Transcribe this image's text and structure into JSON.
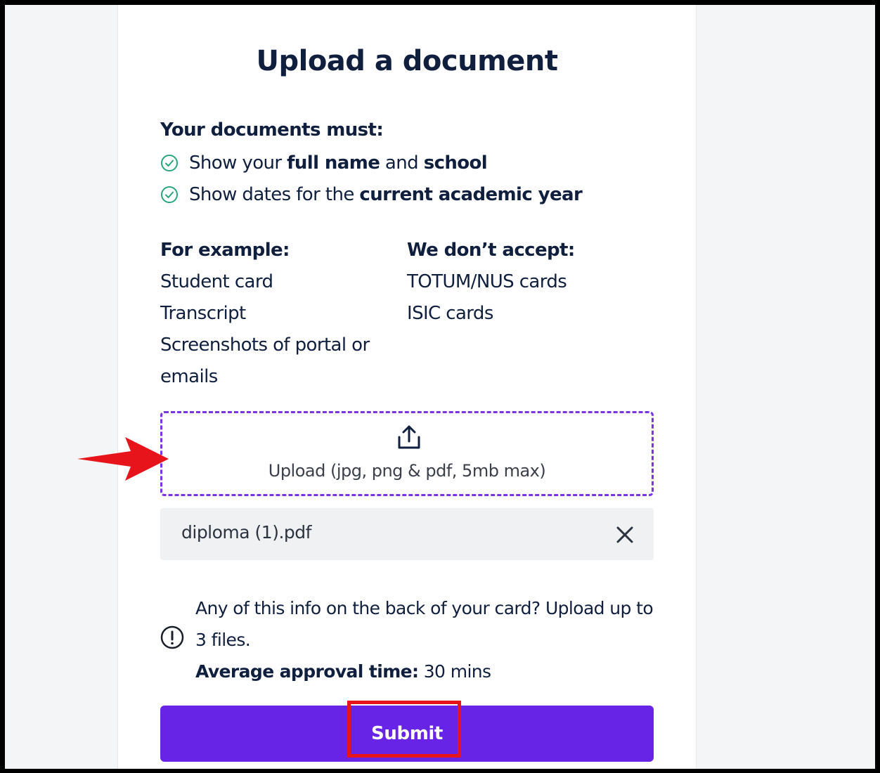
{
  "page": {
    "title": "Upload a document"
  },
  "requirements": {
    "heading": "Your documents must:",
    "items": [
      {
        "parts": [
          "Show your ",
          "full name",
          " and ",
          "school"
        ]
      },
      {
        "parts": [
          "Show dates for the ",
          "current academic year"
        ]
      }
    ]
  },
  "examples": {
    "heading": "For example:",
    "lines": [
      "Student card",
      "Transcript",
      "Screenshots of portal or",
      "emails"
    ]
  },
  "not_accepted": {
    "heading": "We don’t accept:",
    "lines": [
      "TOTUM/NUS cards",
      "ISIC cards"
    ]
  },
  "upload": {
    "label": "Upload (jpg, png & pdf, 5mb max)",
    "icon": "upload-icon",
    "border_color": "#7a34e0"
  },
  "file": {
    "name": "diploma (1).pdf",
    "remove_icon": "close-icon"
  },
  "info": {
    "icon": "exclamation-circle-icon",
    "line1": "Any of this info on the back of your card? Upload up to 3 files.",
    "approval_label": "Average approval time:",
    "approval_value": " 30 mins"
  },
  "submit": {
    "label": "Submit",
    "color": "#6724e6"
  },
  "annotations": {
    "arrow_color": "#e8141c",
    "highlight_color": "#e8141c"
  }
}
